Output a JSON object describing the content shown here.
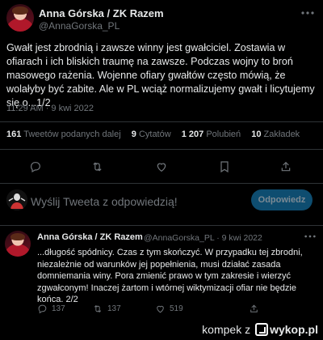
{
  "tweet": {
    "author_name": "Anna Górska / ZK Razem",
    "author_handle": "@AnnaGorska_PL",
    "more_icon": "ellipsis-icon",
    "text": "Gwałt jest zbrodnią i zawsze winny jest gwałciciel. Zostawia w ofiarach i ich bliskich traumę na zawsze. Podczas wojny to broń masowego rażenia. Wojenne ofiary gwałtów często mówią, że wolałyby być zabite. Ale w PL wciąż normalizujemy gwałt i licytujemy się o...1/2",
    "time": "11:29 AM · 9 kwi 2022",
    "stats": {
      "retweets_count": "161",
      "retweets_label": "Tweetów podanych dalej",
      "quotes_count": "9",
      "quotes_label": "Cytatów",
      "likes_count": "1 207",
      "likes_label": "Polubień",
      "bookmarks_count": "10",
      "bookmarks_label": "Zakładek"
    },
    "actions": [
      "reply-icon",
      "retweet-icon",
      "like-icon",
      "bookmark-icon",
      "share-icon"
    ]
  },
  "reply_box": {
    "placeholder": "Wyślij Tweeta z odpowiedzią!",
    "button_label": "Odpowiedz"
  },
  "reply_tweet": {
    "author_name": "Anna Górska / ZK Razem",
    "handle_time": "@AnnaGorska_PL · 9 kwi 2022",
    "text": "...długość spódnicy. Czas z tym skończyć. W przypadku tej zbrodni, niezależnie od warunków jej popełnienia, musi działać zasada domniemania winy. Pora zmienić prawo w tym zakresie i wierzyć zgwałconym! Inaczej żartom i wtórnej wiktymizacji ofiar nie będzie końca. 2/2",
    "reply_count": "137",
    "retweet_count": "137",
    "like_count": "519"
  },
  "watermark": {
    "prefix": "kompek z",
    "brand": "wykop.pl"
  },
  "colors": {
    "background": "#000000",
    "text": "#e7e9ea",
    "muted": "#71767b",
    "divider": "#2f3336",
    "button_bg": "#0e4d70"
  }
}
